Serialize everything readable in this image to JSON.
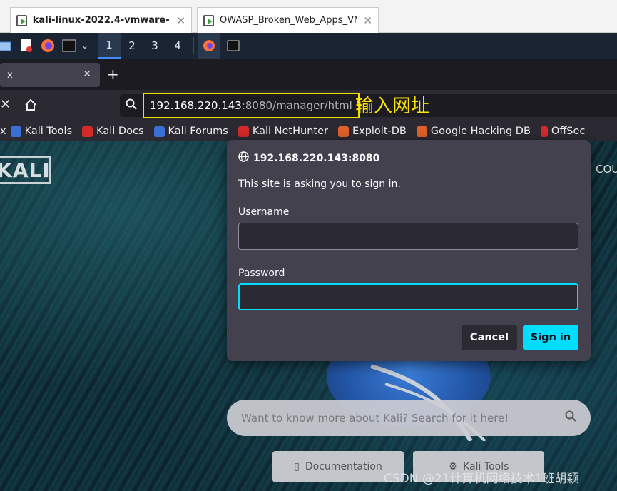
{
  "vm_tabs": [
    {
      "title": "kali-linux-2022.4-vmware-a...",
      "active": true
    },
    {
      "title": "OWASP_Broken_Web_Apps_VM...",
      "active": false
    }
  ],
  "panel": {
    "workspaces": [
      "1",
      "2",
      "3",
      "4"
    ],
    "active_workspace": "1"
  },
  "firefox": {
    "tab_title": "x",
    "tab_close": "✕",
    "new_tab": "+",
    "url": {
      "host": "192.168.220.143",
      "rest": ":8080/manager/html"
    },
    "url_annotation": "输入网址",
    "bookmarks": [
      {
        "label": "Kali Tools",
        "icon": "kali-icon",
        "color": "#3b6fd6"
      },
      {
        "label": "Kali Docs",
        "icon": "docs-icon",
        "color": "#d42a2a"
      },
      {
        "label": "Kali Forums",
        "icon": "forums-icon",
        "color": "#3b6fd6"
      },
      {
        "label": "Kali NetHunter",
        "icon": "nethunter-icon",
        "color": "#d42a2a"
      },
      {
        "label": "Exploit-DB",
        "icon": "exploitdb-icon",
        "color": "#e0612a"
      },
      {
        "label": "Google Hacking DB",
        "icon": "ghdb-icon",
        "color": "#e0612a"
      },
      {
        "label": "OffSec",
        "icon": "offsec-icon",
        "color": "#d42a2a"
      }
    ]
  },
  "page": {
    "logo": "KALI",
    "nav_partial": "COU",
    "search_placeholder": "Want to know more about Kali? Search for it here!",
    "buttons": [
      {
        "label": "Documentation",
        "icon": "book-icon"
      },
      {
        "label": "Kali Tools",
        "icon": "gear-icon"
      }
    ],
    "watermark": "CSDN @21计算机网络技术1班胡颖"
  },
  "dialog": {
    "origin": "192.168.220.143:8080",
    "message": "This site is asking you to sign in.",
    "username_label": "Username",
    "username_value": "",
    "password_label": "Password",
    "password_value": "",
    "cancel_label": "Cancel",
    "signin_label": "Sign in"
  }
}
